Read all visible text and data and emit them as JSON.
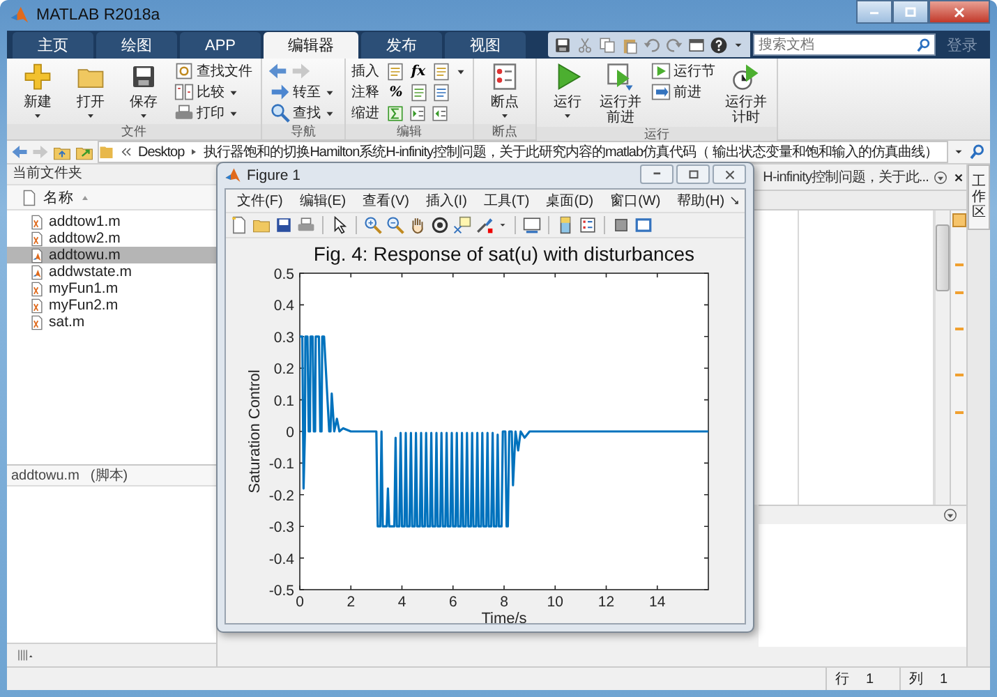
{
  "window": {
    "title": "MATLAB R2018a"
  },
  "tabs": [
    {
      "label": "主页",
      "selected": false
    },
    {
      "label": "绘图",
      "selected": false
    },
    {
      "label": "APP",
      "selected": false
    },
    {
      "label": "编辑器",
      "selected": true
    },
    {
      "label": "发布",
      "selected": false
    },
    {
      "label": "视图",
      "selected": false
    }
  ],
  "search": {
    "placeholder": "搜索文档"
  },
  "sign_in": "登录",
  "ribbon": [
    {
      "label": "文件",
      "columns": [
        {
          "kind": "large",
          "label": "新建",
          "has_menu": true
        },
        {
          "kind": "large",
          "label": "打开",
          "has_menu": true
        },
        {
          "kind": "large",
          "label": "保存",
          "has_menu": true
        },
        {
          "kind": "stack",
          "items": [
            {
              "kind": "button",
              "label": "查找文件",
              "has_menu": false
            },
            {
              "kind": "button",
              "label": "比较",
              "has_menu": true
            },
            {
              "kind": "button",
              "label": "打印",
              "has_menu": true
            }
          ]
        }
      ]
    },
    {
      "label": "导航",
      "columns": [
        {
          "kind": "stack",
          "items": [
            {
              "kind": "arrows"
            },
            {
              "kind": "button",
              "label": "转至",
              "has_menu": true
            },
            {
              "kind": "button",
              "label": "查找",
              "has_menu": true
            }
          ]
        }
      ]
    },
    {
      "label": "编辑",
      "columns": [
        {
          "kind": "edit_rows",
          "rows": [
            {
              "label": "插入",
              "symbol": "fx",
              "has_menu": true
            },
            {
              "label": "注释",
              "symbol": "%",
              "has_menu": false
            },
            {
              "label": "缩进",
              "has_menu": false
            }
          ]
        }
      ]
    },
    {
      "label": "断点",
      "columns": [
        {
          "kind": "large",
          "label": "断点",
          "has_menu": true
        }
      ]
    },
    {
      "label": "运行",
      "columns": [
        {
          "kind": "large",
          "label": "运行",
          "has_menu": true
        },
        {
          "kind": "large",
          "label": "运行并前进",
          "has_menu": false
        },
        {
          "kind": "stack",
          "items": [
            {
              "kind": "button",
              "label": "运行节",
              "has_menu": false
            },
            {
              "kind": "button",
              "label": "前进",
              "has_menu": false
            }
          ]
        },
        {
          "kind": "large",
          "label": "运行并计时",
          "has_menu": false
        }
      ]
    }
  ],
  "address": {
    "path": [
      "Desktop",
      "执行器饱和的切换Hamilton系统H-infinity控制问题，关于此研究内容的matlab仿真代码（ 输出状态变量和饱和输入的仿真曲线）"
    ]
  },
  "current_folder": {
    "title": "当前文件夹",
    "column": "名称",
    "files": [
      {
        "name": "addtow1.m",
        "kind": "function",
        "selected": false
      },
      {
        "name": "addtow2.m",
        "kind": "function",
        "selected": false
      },
      {
        "name": "addtowu.m",
        "kind": "script",
        "selected": true
      },
      {
        "name": "addwstate.m",
        "kind": "script",
        "selected": false
      },
      {
        "name": "myFun1.m",
        "kind": "function",
        "selected": false
      },
      {
        "name": "myFun2.m",
        "kind": "function",
        "selected": false
      },
      {
        "name": "sat.m",
        "kind": "function",
        "selected": false
      }
    ],
    "details": {
      "file": "addtowu.m",
      "type": "(脚本)"
    }
  },
  "editor": {
    "tab": "H-infinity控制问题，关于此..."
  },
  "workspace_tab": "工作区",
  "status_bar": [
    {
      "label": "行",
      "value": "1"
    },
    {
      "label": "列",
      "value": "1"
    }
  ],
  "figure": {
    "title": "Figure 1",
    "menu": [
      "文件(F)",
      "编辑(E)",
      "查看(V)",
      "插入(I)",
      "工具(T)",
      "桌面(D)",
      "窗口(W)",
      "帮助(H)"
    ],
    "chart_data": {
      "type": "line",
      "title": "Fig. 4: Response of sat(u) with disturbances",
      "xlabel": "Time/s",
      "ylabel": "Saturation Control",
      "x": [
        0,
        0.1,
        0.15,
        0.2,
        0.22,
        0.3,
        0.35,
        0.4,
        0.42,
        0.5,
        0.55,
        0.6,
        0.62,
        0.75,
        0.8,
        0.85,
        0.88,
        0.95,
        1.15,
        1.2,
        1.25,
        1.35,
        1.45,
        1.55,
        1.7,
        2,
        3,
        3.05,
        3.15,
        3.2,
        3.25,
        3.4,
        3.45,
        3.5,
        3.7,
        3.75,
        3.8,
        3.9,
        3.95,
        4.0,
        4.1,
        4.15,
        4.2,
        4.3,
        4.35,
        4.4,
        4.5,
        4.55,
        4.6,
        4.7,
        4.75,
        4.8,
        4.9,
        4.95,
        5.0,
        5.1,
        5.15,
        5.2,
        5.3,
        5.35,
        5.4,
        5.5,
        5.55,
        5.6,
        5.7,
        5.75,
        5.8,
        5.9,
        5.95,
        6.0,
        6.1,
        6.15,
        6.2,
        6.3,
        6.35,
        6.4,
        6.5,
        6.55,
        6.6,
        6.7,
        6.75,
        6.8,
        6.9,
        6.95,
        7.0,
        7.1,
        7.15,
        7.2,
        7.3,
        7.35,
        7.4,
        7.5,
        7.55,
        7.6,
        7.7,
        7.75,
        7.8,
        7.9,
        7.95,
        8.05,
        8.1,
        8.15,
        8.2,
        8.3,
        8.35,
        8.45,
        8.55,
        8.65,
        8.8,
        9,
        16
      ],
      "series": [
        {
          "color": "#0072bd",
          "values": [
            0.3,
            0.3,
            -0.18,
            0,
            0.3,
            0.3,
            0,
            0,
            0.3,
            0.3,
            0,
            0,
            0.3,
            0.3,
            0,
            0,
            0.3,
            0.3,
            0,
            0,
            0.12,
            0,
            0.04,
            0,
            0.01,
            0,
            0,
            -0.3,
            -0.3,
            0,
            -0.3,
            -0.3,
            -0.18,
            -0.3,
            -0.3,
            -0.02,
            -0.3,
            -0.3,
            -0.005,
            -0.3,
            -0.3,
            -0.005,
            -0.3,
            -0.3,
            -0.005,
            -0.3,
            -0.3,
            -0.005,
            -0.3,
            -0.3,
            -0.005,
            -0.3,
            -0.3,
            -0.005,
            -0.3,
            -0.3,
            -0.005,
            -0.3,
            -0.3,
            -0.005,
            -0.3,
            -0.3,
            -0.005,
            -0.3,
            -0.3,
            -0.005,
            -0.3,
            -0.3,
            -0.005,
            -0.3,
            -0.3,
            -0.005,
            -0.3,
            -0.3,
            -0.005,
            -0.3,
            -0.3,
            -0.005,
            -0.3,
            -0.3,
            -0.005,
            -0.3,
            -0.3,
            -0.005,
            -0.3,
            -0.3,
            -0.005,
            -0.3,
            -0.3,
            -0.005,
            -0.3,
            -0.3,
            -0.005,
            -0.3,
            -0.3,
            -0.01,
            -0.3,
            -0.3,
            0,
            0,
            -0.3,
            -0.3,
            0,
            0,
            -0.17,
            0,
            -0.06,
            0,
            -0.02,
            0,
            0
          ]
        }
      ],
      "xlim": [
        0,
        16
      ],
      "ylim": [
        -0.5,
        0.5
      ],
      "xticks": [
        0,
        2,
        4,
        6,
        8,
        10,
        12,
        14
      ],
      "yticks": [
        -0.5,
        -0.4,
        -0.3,
        -0.2,
        -0.1,
        0,
        0.1,
        0.2,
        0.3,
        0.4,
        0.5
      ]
    }
  }
}
